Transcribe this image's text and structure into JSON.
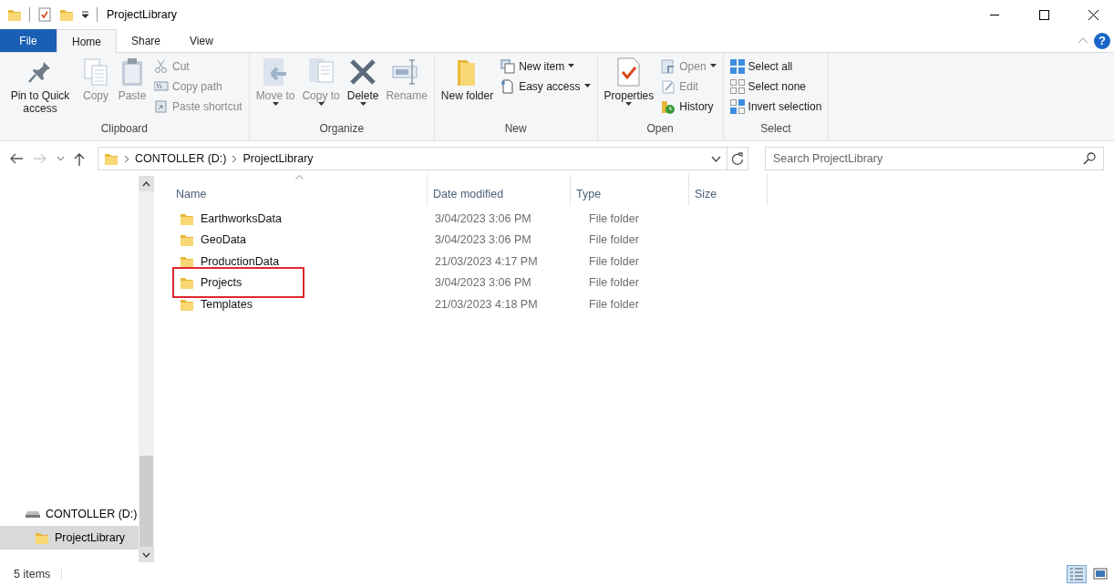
{
  "window": {
    "title": "ProjectLibrary"
  },
  "help": {
    "label": "?"
  },
  "tabs": [
    {
      "label": "File",
      "kind": "file",
      "selected": false
    },
    {
      "label": "Home",
      "kind": "tab",
      "selected": true
    },
    {
      "label": "Share",
      "kind": "tab",
      "selected": false
    },
    {
      "label": "View",
      "kind": "tab",
      "selected": false
    }
  ],
  "ribbon": {
    "groups": [
      {
        "label": "Clipboard",
        "items": [
          {
            "kind": "large",
            "label": "Pin to Quick access",
            "disabled": false,
            "dropdown": false
          },
          {
            "kind": "large",
            "label": "Copy",
            "disabled": true,
            "dropdown": false
          },
          {
            "kind": "large",
            "label": "Paste",
            "disabled": true,
            "dropdown": false
          },
          {
            "kind": "small",
            "label": "Cut",
            "disabled": true,
            "dropdown": false
          },
          {
            "kind": "small",
            "label": "Copy path",
            "disabled": true,
            "dropdown": false
          },
          {
            "kind": "small",
            "label": "Paste shortcut",
            "disabled": true,
            "dropdown": false
          }
        ]
      },
      {
        "label": "Organize",
        "items": [
          {
            "kind": "large",
            "label": "Move to",
            "disabled": true,
            "dropdown": true
          },
          {
            "kind": "large",
            "label": "Copy to",
            "disabled": true,
            "dropdown": true
          },
          {
            "kind": "large",
            "label": "Delete",
            "disabled": false,
            "dropdown": true
          },
          {
            "kind": "large",
            "label": "Rename",
            "disabled": true,
            "dropdown": false
          }
        ]
      },
      {
        "label": "New",
        "items": [
          {
            "kind": "large",
            "label": "New folder",
            "disabled": false,
            "dropdown": false
          },
          {
            "kind": "small",
            "label": "New item",
            "disabled": false,
            "dropdown": true
          },
          {
            "kind": "small",
            "label": "Easy access",
            "disabled": false,
            "dropdown": true
          }
        ]
      },
      {
        "label": "Open",
        "items": [
          {
            "kind": "large",
            "label": "Properties",
            "disabled": false,
            "dropdown": true
          },
          {
            "kind": "small",
            "label": "Open",
            "disabled": true,
            "dropdown": true
          },
          {
            "kind": "small",
            "label": "Edit",
            "disabled": true,
            "dropdown": false
          },
          {
            "kind": "small",
            "label": "History",
            "disabled": false,
            "dropdown": false
          }
        ]
      },
      {
        "label": "Select",
        "items": [
          {
            "kind": "small",
            "label": "Select all",
            "disabled": false,
            "dropdown": false
          },
          {
            "kind": "small",
            "label": "Select none",
            "disabled": false,
            "dropdown": false
          },
          {
            "kind": "small",
            "label": "Invert selection",
            "disabled": false,
            "dropdown": false
          }
        ]
      }
    ]
  },
  "address_bar": {
    "back_disabled": false,
    "forward_disabled": true,
    "breadcrumbs": [
      "CONTOLLER (D:)",
      "ProjectLibrary"
    ]
  },
  "search": {
    "placeholder": "Search ProjectLibrary"
  },
  "navigation": {
    "items": [
      {
        "label": "CONTOLLER (D:)",
        "kind": "drive",
        "selected": false,
        "children": [
          {
            "label": "ProjectLibrary",
            "kind": "folder",
            "selected": true
          }
        ]
      }
    ]
  },
  "table": {
    "columns": [
      {
        "label": "Name",
        "sorted": true
      },
      {
        "label": "Date modified",
        "sorted": false
      },
      {
        "label": "Type",
        "sorted": false
      },
      {
        "label": "Size",
        "sorted": false
      }
    ],
    "rows": [
      {
        "name": "EarthworksData",
        "date": "3/04/2023 3:06 PM",
        "type": "File folder",
        "highlighted": false
      },
      {
        "name": "GeoData",
        "date": "3/04/2023 3:06 PM",
        "type": "File folder",
        "highlighted": false
      },
      {
        "name": "ProductionData",
        "date": "21/03/2023 4:17 PM",
        "type": "File folder",
        "highlighted": false
      },
      {
        "name": "Projects",
        "date": "3/04/2023 3:06 PM",
        "type": "File folder",
        "highlighted": true
      },
      {
        "name": "Templates",
        "date": "21/03/2023 4:18 PM",
        "type": "File folder",
        "highlighted": false
      }
    ]
  },
  "status_bar": {
    "item_count": "5 items",
    "views": [
      {
        "kind": "details",
        "selected": true
      },
      {
        "kind": "large-icons",
        "selected": false
      }
    ]
  }
}
